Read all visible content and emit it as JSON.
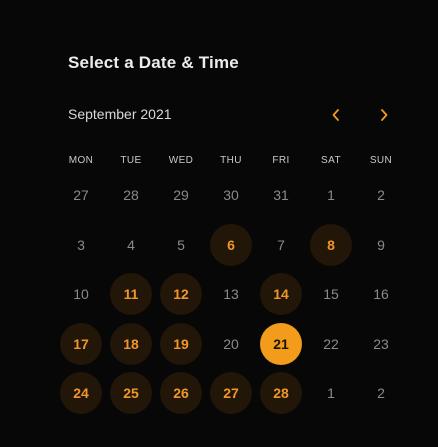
{
  "header": {
    "title": "Select a Date & Time"
  },
  "calendar": {
    "month_label": "September 2021",
    "prev_icon": "chevron-left-icon",
    "next_icon": "chevron-right-icon",
    "weekdays": [
      "MON",
      "TUE",
      "WED",
      "THU",
      "FRI",
      "SAT",
      "SUN"
    ],
    "weeks": [
      [
        {
          "label": "27",
          "state": "disabled"
        },
        {
          "label": "28",
          "state": "disabled"
        },
        {
          "label": "29",
          "state": "disabled"
        },
        {
          "label": "30",
          "state": "disabled"
        },
        {
          "label": "31",
          "state": "disabled"
        },
        {
          "label": "1",
          "state": "disabled"
        },
        {
          "label": "2",
          "state": "disabled"
        }
      ],
      [
        {
          "label": "3",
          "state": "disabled"
        },
        {
          "label": "4",
          "state": "disabled"
        },
        {
          "label": "5",
          "state": "disabled"
        },
        {
          "label": "6",
          "state": "available"
        },
        {
          "label": "7",
          "state": "disabled"
        },
        {
          "label": "8",
          "state": "available"
        },
        {
          "label": "9",
          "state": "disabled"
        }
      ],
      [
        {
          "label": "10",
          "state": "disabled"
        },
        {
          "label": "11",
          "state": "available"
        },
        {
          "label": "12",
          "state": "available"
        },
        {
          "label": "13",
          "state": "disabled"
        },
        {
          "label": "14",
          "state": "available"
        },
        {
          "label": "15",
          "state": "disabled"
        },
        {
          "label": "16",
          "state": "disabled"
        }
      ],
      [
        {
          "label": "17",
          "state": "available"
        },
        {
          "label": "18",
          "state": "available"
        },
        {
          "label": "19",
          "state": "available"
        },
        {
          "label": "20",
          "state": "disabled"
        },
        {
          "label": "21",
          "state": "selected"
        },
        {
          "label": "22",
          "state": "disabled"
        },
        {
          "label": "23",
          "state": "disabled"
        }
      ],
      [
        {
          "label": "24",
          "state": "available"
        },
        {
          "label": "25",
          "state": "available"
        },
        {
          "label": "26",
          "state": "available"
        },
        {
          "label": "27",
          "state": "available"
        },
        {
          "label": "28",
          "state": "available"
        },
        {
          "label": "1",
          "state": "disabled"
        },
        {
          "label": "2",
          "state": "disabled"
        }
      ]
    ]
  },
  "colors": {
    "background": "#070707",
    "accent": "#f39c1c",
    "available_bg": "#211607",
    "available_text": "#f0962a",
    "disabled_text": "#8a8a8a",
    "title_text": "#ececec"
  }
}
